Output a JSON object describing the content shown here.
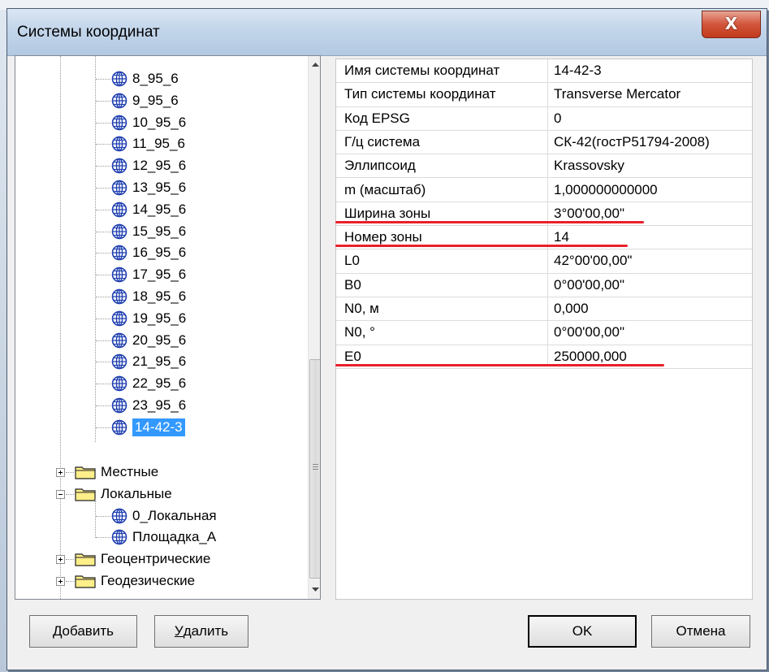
{
  "window": {
    "title": "Системы координат",
    "close_glyph": "X"
  },
  "tree": {
    "items": [
      {
        "label": "8_95_6",
        "icon": "globe-icon"
      },
      {
        "label": "9_95_6",
        "icon": "globe-icon"
      },
      {
        "label": "10_95_6",
        "icon": "globe-icon"
      },
      {
        "label": "11_95_6",
        "icon": "globe-icon"
      },
      {
        "label": "12_95_6",
        "icon": "globe-icon"
      },
      {
        "label": "13_95_6",
        "icon": "globe-icon"
      },
      {
        "label": "14_95_6",
        "icon": "globe-icon"
      },
      {
        "label": "15_95_6",
        "icon": "globe-icon"
      },
      {
        "label": "16_95_6",
        "icon": "globe-icon"
      },
      {
        "label": "17_95_6",
        "icon": "globe-icon"
      },
      {
        "label": "18_95_6",
        "icon": "globe-icon"
      },
      {
        "label": "19_95_6",
        "icon": "globe-icon"
      },
      {
        "label": "20_95_6",
        "icon": "globe-icon"
      },
      {
        "label": "21_95_6",
        "icon": "globe-icon"
      },
      {
        "label": "22_95_6",
        "icon": "globe-icon"
      },
      {
        "label": "23_95_6",
        "icon": "globe-icon"
      },
      {
        "label": "14-42-3",
        "icon": "globe-icon",
        "selected": true
      }
    ],
    "folders": [
      {
        "label": "Местные",
        "expanded": false
      },
      {
        "label": "Локальные",
        "expanded": true,
        "children": [
          "0_Локальная",
          "Площадка_А"
        ]
      },
      {
        "label": "Геоцентрические",
        "expanded": false
      },
      {
        "label": "Геодезические",
        "expanded": false
      }
    ]
  },
  "properties": [
    {
      "key": "Имя системы координат",
      "value": "14-42-3"
    },
    {
      "key": "Тип системы координат",
      "value": "Transverse Mercator"
    },
    {
      "key": "Код EPSG",
      "value": "0"
    },
    {
      "key": "Г/ц система",
      "value": "СК-42(гостР51794-2008)"
    },
    {
      "key": "Эллипсоид",
      "value": "Krassovsky"
    },
    {
      "key": "m (масштаб)",
      "value": "1,000000000000"
    },
    {
      "key": "Ширина зоны",
      "value": " 3°00'00,00\"",
      "highlighted": true
    },
    {
      "key": "Номер зоны",
      "value": "14",
      "highlighted": true
    },
    {
      "key": "L0",
      "value": " 42°00'00,00\""
    },
    {
      "key": "B0",
      "value": " 0°00'00,00\""
    },
    {
      "key": "N0, м",
      "value": "0,000"
    },
    {
      "key": "N0, °",
      "value": " 0°00'00,00\""
    },
    {
      "key": "E0",
      "value": "250000,000",
      "highlighted": true
    }
  ],
  "buttons": {
    "add": {
      "u": "Д",
      "rest": "обавить"
    },
    "delete": {
      "u": "У",
      "rest": "далить"
    },
    "ok": "OK",
    "cancel": "Отмена"
  },
  "colors": {
    "selection": "#3399ff",
    "highlight_line": "#e8202a",
    "close_button": "#c94a2c"
  }
}
